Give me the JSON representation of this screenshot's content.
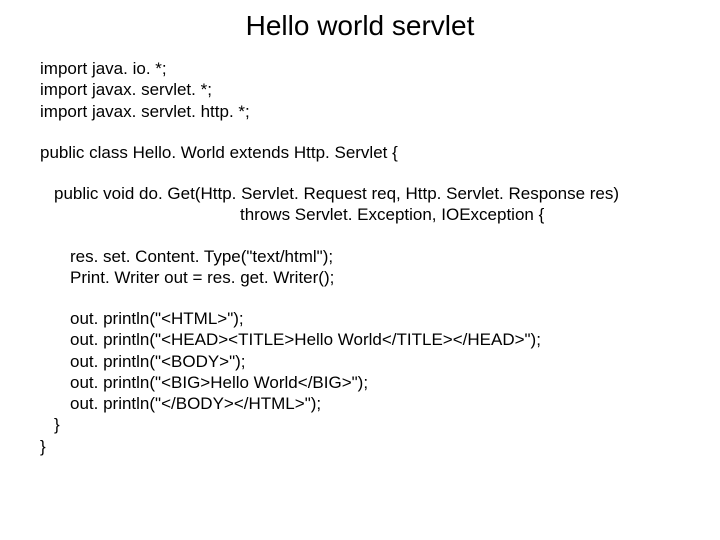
{
  "title": "Hello world servlet",
  "code": {
    "l1": "import java. io. *;",
    "l2": "import javax. servlet. *;",
    "l3": "import javax. servlet. http. *;",
    "l4": "public class Hello. World extends Http. Servlet {",
    "l5": "public void do. Get(Http. Servlet. Request req, Http. Servlet. Response res)",
    "l6": "throws Servlet. Exception, IOException {",
    "l7": "res. set. Content. Type(\"text/html\");",
    "l8": "Print. Writer out = res. get. Writer();",
    "l9": "out. println(\"<HTML>\");",
    "l10": "out. println(\"<HEAD><TITLE>Hello World</TITLE></HEAD>\");",
    "l11": "out. println(\"<BODY>\");",
    "l12": "out. println(\"<BIG>Hello World</BIG>\");",
    "l13": "out. println(\"</BODY></HTML>\");",
    "l14": "}",
    "l15": "}"
  }
}
